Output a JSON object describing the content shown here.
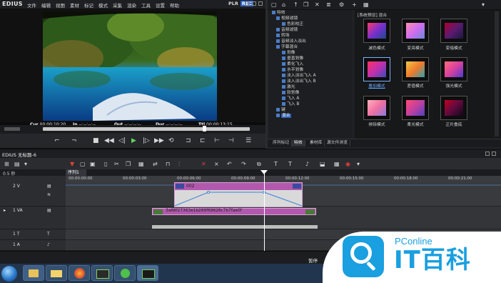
{
  "app": {
    "logo": "EDIUS",
    "menus": [
      "文件",
      "编辑",
      "视图",
      "素材",
      "标记",
      "模式",
      "采集",
      "渲染",
      "工具",
      "设置",
      "帮助"
    ],
    "plr_label": "PLR",
    "rec_label": "REC"
  },
  "player": {
    "timecodes": [
      {
        "label": "Cur",
        "value": "00:00:10:20"
      },
      {
        "label": "In",
        "value": "--:--:--:--"
      },
      {
        "label": "Out",
        "value": "--:--:--:--"
      },
      {
        "label": "Dur",
        "value": "--:--:--:--"
      },
      {
        "label": "Ttl",
        "value": "00:00:13:15"
      }
    ]
  },
  "effects": {
    "tree": [
      {
        "label": "特效",
        "level": 0
      },
      {
        "label": "视频滤镜",
        "level": 1
      },
      {
        "label": "色彩校正",
        "level": 2
      },
      {
        "label": "音频滤镜",
        "level": 1
      },
      {
        "label": "转场",
        "level": 1
      },
      {
        "label": "音频淡入淡出",
        "level": 1
      },
      {
        "label": "字幕混合",
        "level": 1
      },
      {
        "label": "划像",
        "level": 2
      },
      {
        "label": "垂直划像",
        "level": 2
      },
      {
        "label": "柔化飞入",
        "level": 2
      },
      {
        "label": "水平划像",
        "level": 2
      },
      {
        "label": "淡入淡出飞入 A",
        "level": 2
      },
      {
        "label": "淡入淡出飞入 B",
        "level": 2
      },
      {
        "label": "激光",
        "level": 2
      },
      {
        "label": "软划像",
        "level": 2
      },
      {
        "label": "飞入 A",
        "level": 2
      },
      {
        "label": "飞入 B",
        "level": 2
      },
      {
        "label": "键",
        "level": 1
      },
      {
        "label": "混合",
        "level": 1,
        "selected": true
      }
    ],
    "thumbs_header": "[系统预设] 混合",
    "thumbs": [
      {
        "label": "减色模式",
        "selected": false
      },
      {
        "label": "变亮模式",
        "selected": false
      },
      {
        "label": "变暗模式",
        "selected": false
      },
      {
        "label": "叠加模式",
        "selected": true
      },
      {
        "label": "差值模式",
        "selected": false
      },
      {
        "label": "强光模式",
        "selected": false
      },
      {
        "label": "排除模式",
        "selected": false
      },
      {
        "label": "柔光模式",
        "selected": false
      },
      {
        "label": "正片叠底",
        "selected": false
      }
    ],
    "tabs": [
      "序列标记",
      "特效",
      "素材库",
      "源文件浏览"
    ]
  },
  "timeline": {
    "title": "EDIUS 无标题-6",
    "sequence_tab": "序列1",
    "zoom": "0.5 秒",
    "ruler": [
      "00:00:00:00",
      "00:00:03:00",
      "00:00:06:00",
      "00:00:09:00",
      "00:00:12:00",
      "00:00:15:00",
      "00:00:18:00",
      "00:00:21:00"
    ],
    "tracks": [
      {
        "label": "2 V"
      },
      {
        "label": "1 VA"
      },
      {
        "label": "1 T"
      },
      {
        "label": "1 A"
      }
    ],
    "clip_v_label": "002",
    "clip_va_label": "3a68f27363e1b289f69628c7b7fae0f"
  },
  "status": {
    "text": "暂停"
  },
  "watermark": {
    "small": "PConline",
    "big": "IT百科"
  }
}
